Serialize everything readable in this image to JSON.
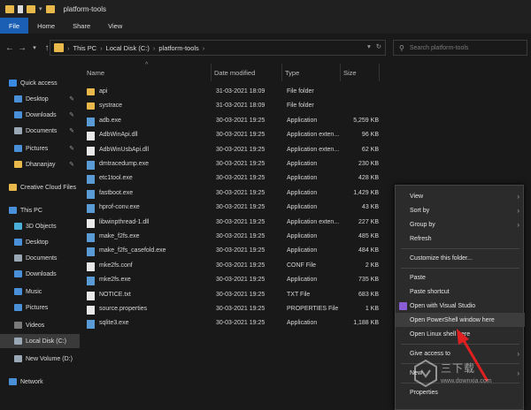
{
  "window": {
    "title": "platform-tools"
  },
  "ribbon": {
    "tabs": [
      "File",
      "Home",
      "Share",
      "View"
    ]
  },
  "address": {
    "parts": [
      "This PC",
      "Local Disk (C:)",
      "platform-tools"
    ]
  },
  "search": {
    "placeholder": "Search platform-tools"
  },
  "sidebar": {
    "items": [
      {
        "label": "Quick access",
        "icon": "star-icon",
        "color": "#3a8be0",
        "pinned": false,
        "indent": 0
      },
      {
        "label": "Desktop",
        "icon": "desktop-icon",
        "color": "#4a90d9",
        "pinned": true,
        "indent": 1
      },
      {
        "label": "Downloads",
        "icon": "download-icon",
        "color": "#4a90d9",
        "pinned": true,
        "indent": 1
      },
      {
        "label": "Documents",
        "icon": "documents-icon",
        "color": "#9aa7b4",
        "pinned": true,
        "indent": 1
      },
      {
        "label": "Pictures",
        "icon": "pictures-icon",
        "color": "#4a90d9",
        "pinned": true,
        "indent": 1
      },
      {
        "label": "Dhananjay",
        "icon": "folder-icon",
        "color": "#e8b94a",
        "pinned": true,
        "indent": 1
      },
      {
        "label": "Creative Cloud Files",
        "icon": "creative-cloud-icon",
        "color": "#e8b94a",
        "pinned": false,
        "indent": 0
      },
      {
        "label": "This PC",
        "icon": "computer-icon",
        "color": "#4a90d9",
        "pinned": false,
        "indent": 0
      },
      {
        "label": "3D Objects",
        "icon": "3d-objects-icon",
        "color": "#4ab0d9",
        "pinned": false,
        "indent": 1
      },
      {
        "label": "Desktop",
        "icon": "desktop-icon",
        "color": "#4a90d9",
        "pinned": false,
        "indent": 1
      },
      {
        "label": "Documents",
        "icon": "documents-icon",
        "color": "#9aa7b4",
        "pinned": false,
        "indent": 1
      },
      {
        "label": "Downloads",
        "icon": "download-icon",
        "color": "#4a90d9",
        "pinned": false,
        "indent": 1
      },
      {
        "label": "Music",
        "icon": "music-icon",
        "color": "#4a90d9",
        "pinned": false,
        "indent": 1
      },
      {
        "label": "Pictures",
        "icon": "pictures-icon",
        "color": "#4a90d9",
        "pinned": false,
        "indent": 1
      },
      {
        "label": "Videos",
        "icon": "videos-icon",
        "color": "#7a7a7a",
        "pinned": false,
        "indent": 1
      },
      {
        "label": "Local Disk (C:)",
        "icon": "drive-icon",
        "color": "#9aa7b4",
        "pinned": false,
        "indent": 1,
        "selected": true
      },
      {
        "label": "New Volume (D:)",
        "icon": "drive-icon",
        "color": "#9aa7b4",
        "pinned": false,
        "indent": 1
      },
      {
        "label": "Network",
        "icon": "network-icon",
        "color": "#4a90d9",
        "pinned": false,
        "indent": 0
      }
    ]
  },
  "columns": {
    "name": "Name",
    "date": "Date modified",
    "type": "Type",
    "size": "Size"
  },
  "files": [
    {
      "name": "api",
      "date": "31-03-2021 18:09",
      "type": "File folder",
      "size": "",
      "kind": "folder"
    },
    {
      "name": "systrace",
      "date": "31-03-2021 18:09",
      "type": "File folder",
      "size": "",
      "kind": "folder"
    },
    {
      "name": "adb.exe",
      "date": "30-03-2021 19:25",
      "type": "Application",
      "size": "5,259 KB",
      "kind": "exe"
    },
    {
      "name": "AdbWinApi.dll",
      "date": "30-03-2021 19:25",
      "type": "Application exten...",
      "size": "96 KB",
      "kind": "file"
    },
    {
      "name": "AdbWinUsbApi.dll",
      "date": "30-03-2021 19:25",
      "type": "Application exten...",
      "size": "62 KB",
      "kind": "file"
    },
    {
      "name": "dmtracedump.exe",
      "date": "30-03-2021 19:25",
      "type": "Application",
      "size": "230 KB",
      "kind": "exe"
    },
    {
      "name": "etc1tool.exe",
      "date": "30-03-2021 19:25",
      "type": "Application",
      "size": "428 KB",
      "kind": "exe"
    },
    {
      "name": "fastboot.exe",
      "date": "30-03-2021 19:25",
      "type": "Application",
      "size": "1,429 KB",
      "kind": "exe"
    },
    {
      "name": "hprof-conv.exe",
      "date": "30-03-2021 19:25",
      "type": "Application",
      "size": "43 KB",
      "kind": "exe"
    },
    {
      "name": "libwinpthread-1.dll",
      "date": "30-03-2021 19:25",
      "type": "Application exten...",
      "size": "227 KB",
      "kind": "file"
    },
    {
      "name": "make_f2fs.exe",
      "date": "30-03-2021 19:25",
      "type": "Application",
      "size": "485 KB",
      "kind": "exe"
    },
    {
      "name": "make_f2fs_casefold.exe",
      "date": "30-03-2021 19:25",
      "type": "Application",
      "size": "484 KB",
      "kind": "exe"
    },
    {
      "name": "mke2fs.conf",
      "date": "30-03-2021 19:25",
      "type": "CONF File",
      "size": "2 KB",
      "kind": "file"
    },
    {
      "name": "mke2fs.exe",
      "date": "30-03-2021 19:25",
      "type": "Application",
      "size": "735 KB",
      "kind": "exe"
    },
    {
      "name": "NOTICE.txt",
      "date": "30-03-2021 19:25",
      "type": "TXT File",
      "size": "683 KB",
      "kind": "file"
    },
    {
      "name": "source.properties",
      "date": "30-03-2021 19:25",
      "type": "PROPERTIES File",
      "size": "1 KB",
      "kind": "file"
    },
    {
      "name": "sqlite3.exe",
      "date": "30-03-2021 19:25",
      "type": "Application",
      "size": "1,188 KB",
      "kind": "exe"
    }
  ],
  "context_menu": {
    "items": [
      {
        "label": "View",
        "submenu": true
      },
      {
        "label": "Sort by",
        "submenu": true
      },
      {
        "label": "Group by",
        "submenu": true
      },
      {
        "label": "Refresh",
        "submenu": false
      },
      {
        "sep": true
      },
      {
        "label": "Customize this folder...",
        "submenu": false
      },
      {
        "sep": true
      },
      {
        "label": "Paste",
        "submenu": false
      },
      {
        "label": "Paste shortcut",
        "submenu": false
      },
      {
        "label": "Open with Visual Studio",
        "submenu": false,
        "icon": "visual-studio-icon"
      },
      {
        "label": "Open PowerShell window here",
        "submenu": false,
        "highlight": true
      },
      {
        "label": "Open Linux shell here",
        "submenu": false
      },
      {
        "sep": true
      },
      {
        "label": "Give access to",
        "submenu": true
      },
      {
        "sep": true
      },
      {
        "label": "New",
        "submenu": true
      },
      {
        "sep": true
      },
      {
        "label": "Properties",
        "submenu": false
      }
    ]
  },
  "watermark": {
    "text": "三下载",
    "url": "www.downxia.com"
  },
  "colors": {
    "accent": "#1a5fb4",
    "arrow": "#e02020"
  }
}
